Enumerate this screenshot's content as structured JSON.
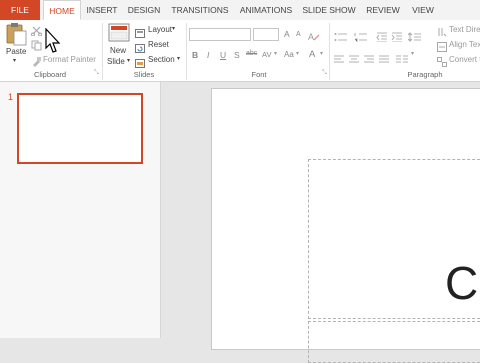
{
  "tabs": [
    "FILE",
    "HOME",
    "INSERT",
    "DESIGN",
    "TRANSITIONS",
    "ANIMATIONS",
    "SLIDE SHOW",
    "REVIEW",
    "VIEW"
  ],
  "active_tab": "HOME",
  "accent_color": "#d24726",
  "clipboard": {
    "paste_label": "Paste",
    "format_painter_label": "Format Painter",
    "group_label": "Clipboard"
  },
  "slides_group": {
    "new_slide_label_1": "New",
    "new_slide_label_2": "Slide",
    "layout_label": "Layout",
    "reset_label": "Reset",
    "section_label": "Section",
    "group_label": "Slides"
  },
  "font_group": {
    "group_label": "Font",
    "bold": "B",
    "italic": "I",
    "underline": "U",
    "strikethrough": "S",
    "shadow_abc": "abc",
    "spacing": "AV",
    "case": "Aa",
    "color": "A",
    "grow": "A",
    "shrink": "A"
  },
  "paragraph_group": {
    "group_label": "Paragraph",
    "text_direction": "Text Dire",
    "align_text": "Align Tex",
    "convert_to": "Convert t"
  },
  "slide_panel": {
    "slide_number": "1"
  },
  "slide": {
    "title_partial": "Cl"
  }
}
